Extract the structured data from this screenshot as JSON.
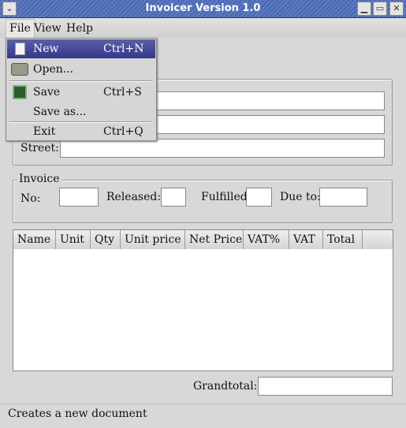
{
  "window": {
    "title": "Invoicer Version 1.0",
    "menu_icon": "chevron-down-icon",
    "minimize_icon": "minimize-icon",
    "maximize_icon": "maximize-icon",
    "close_icon": "close-icon"
  },
  "menubar": [
    {
      "label": "File"
    },
    {
      "label": "View"
    },
    {
      "label": "Help"
    }
  ],
  "file_menu": [
    {
      "label": "New",
      "shortcut": "Ctrl+N",
      "icon": "new-document-icon",
      "selected": true
    },
    {
      "label": "Open...",
      "shortcut": "",
      "icon": "folder-open-icon"
    },
    {
      "label": "Save",
      "shortcut": "Ctrl+S",
      "icon": "floppy-save-icon"
    },
    {
      "label": "Save as...",
      "shortcut": ""
    },
    {
      "label": "Exit",
      "shortcut": "Ctrl+Q"
    }
  ],
  "customer": {
    "street_label": "Street:",
    "field1": "",
    "field2": "",
    "street": ""
  },
  "invoice": {
    "title": "Invoice",
    "no_label": "No:",
    "released_label": "Released:",
    "fulfilled_label": "Fulfilled:",
    "due_label": "Due to:"
  },
  "table": {
    "columns": [
      "Name",
      "Unit",
      "Qty",
      "Unit price",
      "Net Price",
      "VAT%",
      "VAT",
      "Total"
    ],
    "rows": []
  },
  "grandtotal": {
    "label": "Grandtotal:",
    "value": ""
  },
  "status": "Creates a new document"
}
